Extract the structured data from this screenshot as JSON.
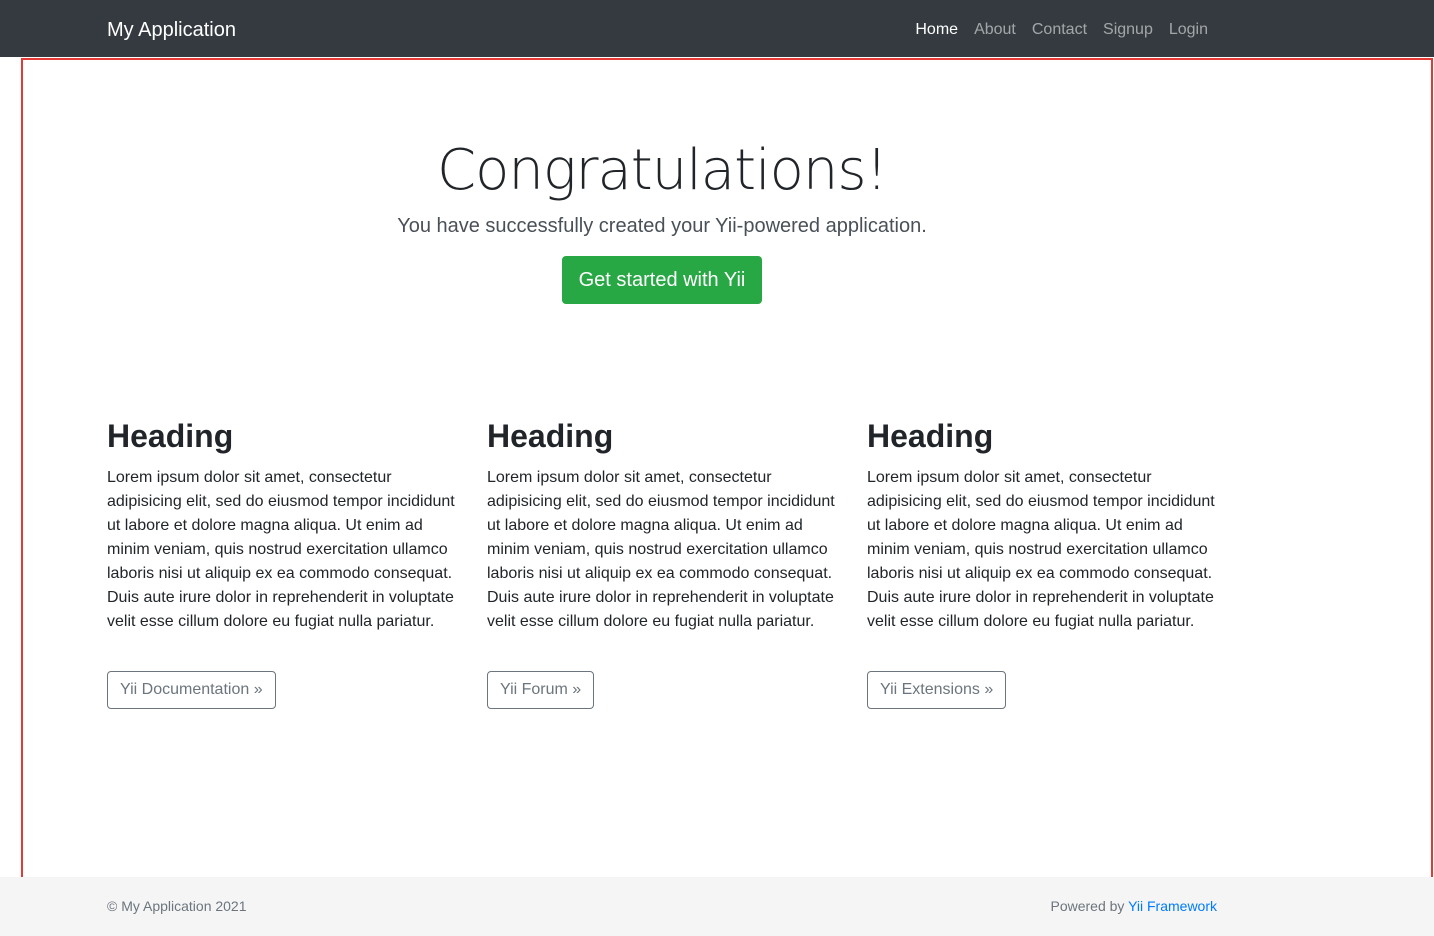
{
  "navbar": {
    "brand": "My Application",
    "items": [
      {
        "label": "Home",
        "active": true
      },
      {
        "label": "About",
        "active": false
      },
      {
        "label": "Contact",
        "active": false
      },
      {
        "label": "Signup",
        "active": false
      },
      {
        "label": "Login",
        "active": false
      }
    ]
  },
  "jumbotron": {
    "title": "Congratulations!",
    "lead": "You have successfully created your Yii-powered application.",
    "button_label": "Get started with Yii"
  },
  "columns": [
    {
      "heading": "Heading",
      "body": "Lorem ipsum dolor sit amet, consectetur adipisicing elit, sed do eiusmod tempor incididunt ut labore et dolore magna aliqua. Ut enim ad minim veniam, quis nostrud exercitation ullamco laboris nisi ut aliquip ex ea commodo consequat. Duis aute irure dolor in reprehenderit in voluptate velit esse cillum dolore eu fugiat nulla pariatur.",
      "button_label": "Yii Documentation »"
    },
    {
      "heading": "Heading",
      "body": "Lorem ipsum dolor sit amet, consectetur adipisicing elit, sed do eiusmod tempor incididunt ut labore et dolore magna aliqua. Ut enim ad minim veniam, quis nostrud exercitation ullamco laboris nisi ut aliquip ex ea commodo consequat. Duis aute irure dolor in reprehenderit in voluptate velit esse cillum dolore eu fugiat nulla pariatur.",
      "button_label": "Yii Forum »"
    },
    {
      "heading": "Heading",
      "body": "Lorem ipsum dolor sit amet, consectetur adipisicing elit, sed do eiusmod tempor incididunt ut labore et dolore magna aliqua. Ut enim ad minim veniam, quis nostrud exercitation ullamco laboris nisi ut aliquip ex ea commodo consequat. Duis aute irure dolor in reprehenderit in voluptate velit esse cillum dolore eu fugiat nulla pariatur.",
      "button_label": "Yii Extensions »"
    }
  ],
  "footer": {
    "copyright": "© My Application 2021",
    "powered_prefix": "Powered by ",
    "powered_link": "Yii Framework"
  },
  "colors": {
    "navbar_bg": "#343a40",
    "success": "#28a745",
    "highlight_border": "#e53935",
    "link": "#007bff"
  }
}
